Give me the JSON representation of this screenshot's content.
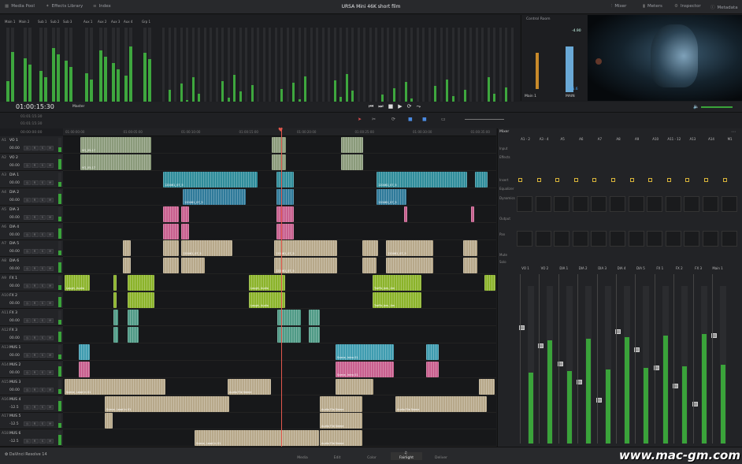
{
  "top": {
    "left": [
      {
        "label": "Media Pool",
        "icon": "media-pool-icon"
      },
      {
        "label": "Effects Library",
        "icon": "effects-icon"
      },
      {
        "label": "Index",
        "icon": "index-icon"
      }
    ],
    "title": "URSA Mini 46K short film",
    "right": [
      {
        "label": "Mixer",
        "icon": "mixer-icon"
      },
      {
        "label": "Meters",
        "icon": "meters-icon"
      },
      {
        "label": "Inspector",
        "icon": "inspector-icon"
      },
      {
        "label": "Metadata",
        "icon": "metadata-icon"
      }
    ]
  },
  "meters": {
    "groups": [
      "Main 1",
      "Main 2",
      "Sub 1",
      "Sub 2",
      "Sub 3",
      "Aux 1",
      "Aux 2",
      "Aux 3",
      "Aux 4",
      "Grp 1"
    ],
    "control_room": "Control Room",
    "main": "Main 1",
    "main_right": "MAIN",
    "loudness": "-4.90",
    "loudness2": "-25.6"
  },
  "transport": {
    "timecode": "01:00:15:30",
    "selector": "Master",
    "tc2": "01:01:15:30",
    "tc3": "01:01:15:30",
    "tc4": "00:00:00:00"
  },
  "ruler": [
    "01:00:00:00",
    "01:00:05:00",
    "01:00:10:00",
    "01:00:15:00",
    "01:00:20:00",
    "01:00:25:00",
    "01:00:30:00",
    "01:00:35:00"
  ],
  "tracks": [
    {
      "id": "A1",
      "name": "VO 1",
      "vol": "00.00",
      "color": "#8a9a7a"
    },
    {
      "id": "A2",
      "name": "VO 2",
      "vol": "00.00",
      "color": "#8a9a7a"
    },
    {
      "id": "A3",
      "name": "DIA 1",
      "vol": "00.00",
      "color": "#2f8c9a"
    },
    {
      "id": "A4",
      "name": "DIA 2",
      "vol": "00.00",
      "color": "#2f7a9a"
    },
    {
      "id": "A5",
      "name": "DIA 3",
      "vol": "00.00",
      "color": "#c85f8e"
    },
    {
      "id": "A6",
      "name": "DIA 4",
      "vol": "00.00",
      "color": "#c85f8e"
    },
    {
      "id": "A7",
      "name": "DIA 5",
      "vol": "00.00",
      "color": "#b7a88a"
    },
    {
      "id": "A8",
      "name": "DIA 6",
      "vol": "00.00",
      "color": "#b7a88a"
    },
    {
      "id": "A9",
      "name": "FX 1",
      "vol": "00.00",
      "color": "#8bb32a"
    },
    {
      "id": "A10",
      "name": "FX 2",
      "vol": "00.00",
      "color": "#8bb32a"
    },
    {
      "id": "A11",
      "name": "FX 3",
      "vol": "00.00",
      "color": "#4f9a86"
    },
    {
      "id": "A12",
      "name": "FX 3",
      "vol": "00.00",
      "color": "#4f9a86"
    },
    {
      "id": "A13",
      "name": "MUS 1",
      "vol": "00.00",
      "color": "#3f9cb0"
    },
    {
      "id": "A14",
      "name": "MUS 2",
      "vol": "00.00",
      "color": "#c85f8e"
    },
    {
      "id": "A15",
      "name": "MUS 3",
      "vol": "00.00",
      "color": "#b7a88a"
    },
    {
      "id": "A16",
      "name": "MUS 4",
      "vol": "-12.5",
      "color": "#b7a88a"
    },
    {
      "id": "A17",
      "name": "MUS 5",
      "vol": "-12.5",
      "color": "#b7a88a"
    },
    {
      "id": "A18",
      "name": "MUS 6",
      "vol": "-12.5",
      "color": "#b7a88a"
    }
  ],
  "clip_labels": {
    "vo1": "VO_05-17",
    "vo2": "VO_05-17",
    "dia": "120461_07_5",
    "fx": "Laugh, Audio",
    "traffic": "Traffic Jam, Am",
    "mus": "Scene, Intro 01",
    "mus2": "Scene, Lead In 01",
    "afs": "Audio File Name"
  },
  "mixer": {
    "title": "Mixer",
    "channels": [
      "A1 - 2",
      "A3 - 4",
      "A5",
      "A6",
      "A7",
      "A8",
      "A9",
      "A10",
      "A11 - 12",
      "A13",
      "A14",
      "M1"
    ],
    "bottom": [
      "VO 1",
      "VO 2",
      "DIA 1",
      "DIA 2",
      "DIA 3",
      "DIA 4",
      "DIA 5",
      "FX 1",
      "FX 2",
      "FX 3",
      "Main 1"
    ],
    "rows": [
      "Input",
      "Effects",
      "Insert",
      "Equalizer",
      "Dynamics",
      "Output",
      "Pan",
      "Mute",
      "Solo"
    ]
  },
  "pages": [
    "Media",
    "Edit",
    "Color",
    "Fairlight",
    "Deliver"
  ],
  "active_page": "Fairlight",
  "app": "DaVinci Resolve 14",
  "watermark": "www.mac-gm.com"
}
